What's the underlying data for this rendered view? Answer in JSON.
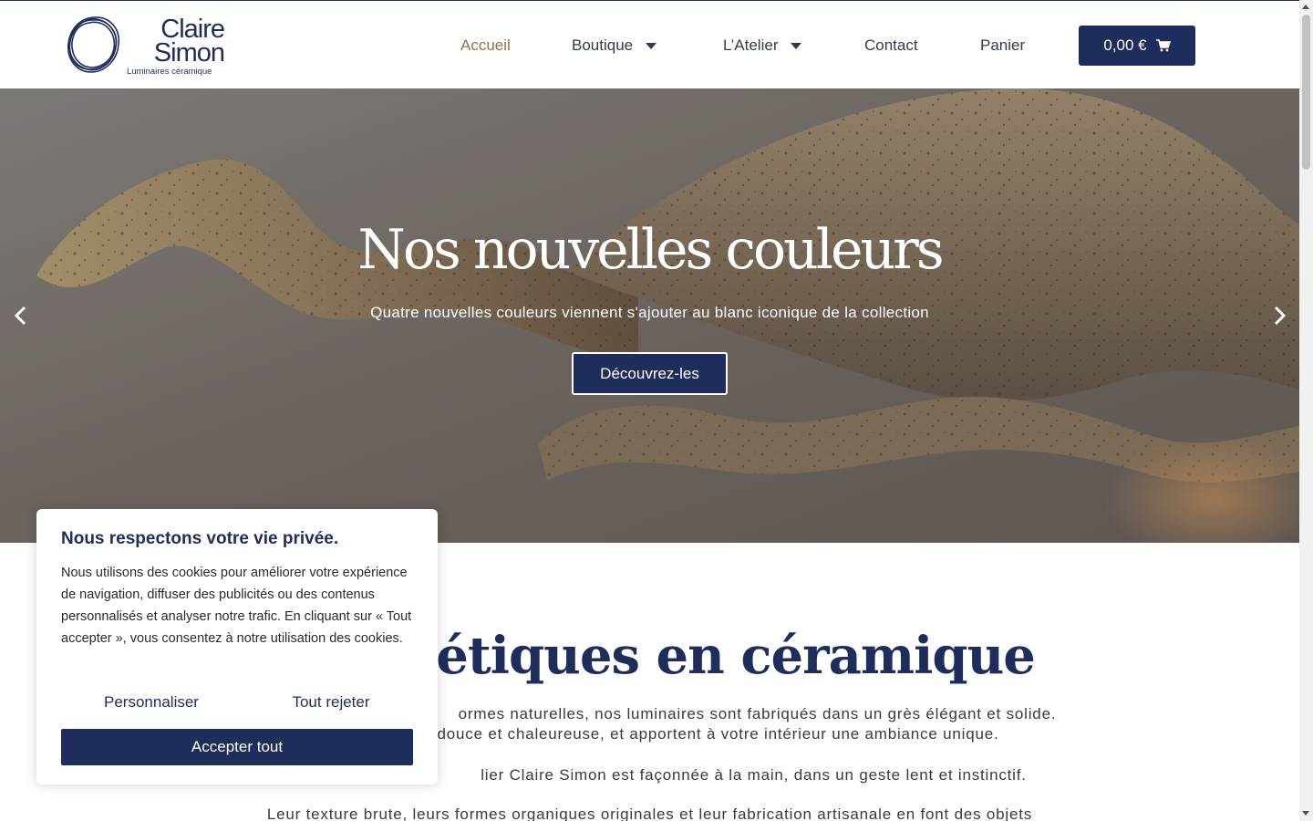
{
  "brand": {
    "name_line1": "Claire",
    "name_line2": "Simon",
    "tagline": "Luminaires céramique"
  },
  "nav": {
    "items": [
      {
        "label": "Accueil",
        "active": true,
        "dropdown": false
      },
      {
        "label": "Boutique",
        "active": false,
        "dropdown": true
      },
      {
        "label": "L’Atelier",
        "active": false,
        "dropdown": true
      },
      {
        "label": "Contact",
        "active": false,
        "dropdown": false
      },
      {
        "label": "Panier",
        "active": false,
        "dropdown": false
      }
    ],
    "cart_total": "0,00 €",
    "cart_icon": "cart-icon"
  },
  "hero": {
    "title": "Nos nouvelles couleurs",
    "subtitle": "Quatre nouvelles couleurs viennent s'ajouter au blanc iconique de la collection",
    "button_label": "Découvrez-les",
    "prev_icon": "chevron-left-icon",
    "next_icon": "chevron-right-icon"
  },
  "main": {
    "title": "es poétiques en céramique",
    "para1_line1": "ormes naturelles, nos luminaires sont fabriqués dans un grès élégant et solide.",
    "para1_line2": "douce et chaleureuse, et apportent à votre intérieur une ambiance unique.",
    "para2": "lier Claire Simon est façonnée à la main, dans un geste lent et instinctif.",
    "para3": "Leur texture brute, leurs formes organiques originales et leur fabrication artisanale en font des objets"
  },
  "cookie": {
    "title": "Nous respectons votre vie privée.",
    "text": "Nous utilisons des cookies pour améliorer votre expérience de navigation, diffuser des publicités ou des contenus personnalisés et analyser notre trafic. En cliquant sur « Tout accepter », vous consentez à notre utilisation des cookies.",
    "customize_label": "Personnaliser",
    "reject_label": "Tout rejeter",
    "accept_label": "Accepter tout"
  },
  "colors": {
    "brand_navy": "#1f2d5c",
    "active_nav": "#9b6e4a"
  }
}
